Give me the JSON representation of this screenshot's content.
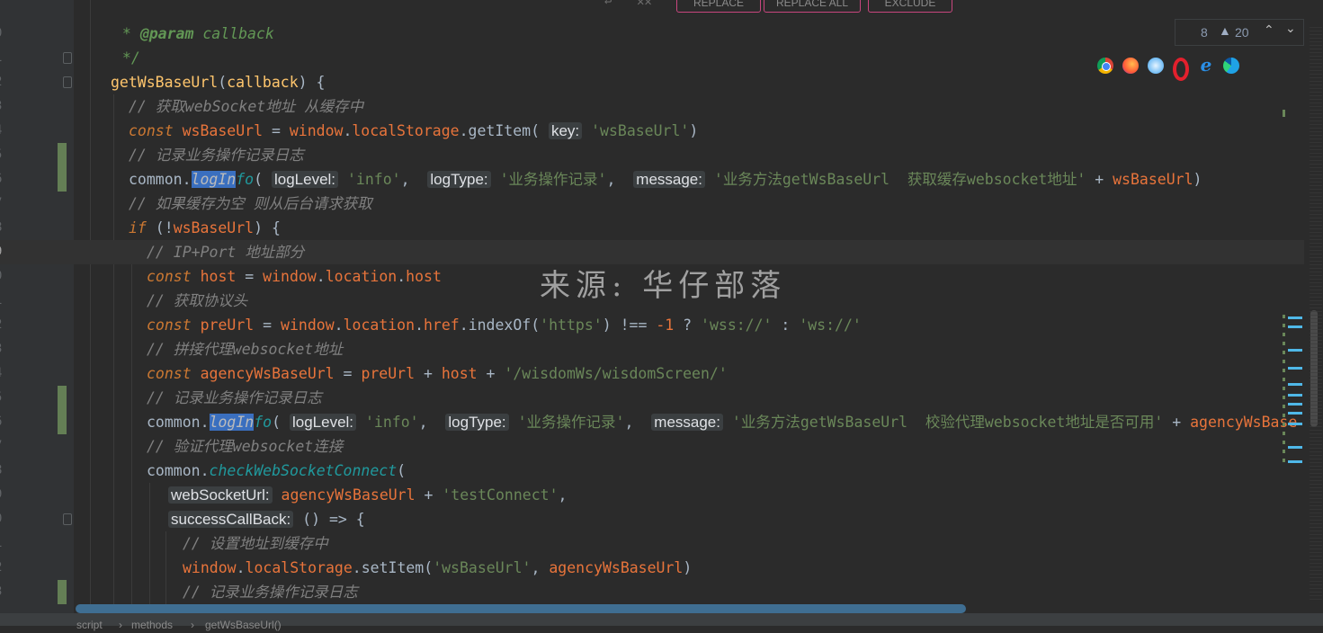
{
  "toolbar": {
    "replace_label": "REPLACE",
    "replace_all_label": "REPLACE ALL",
    "exclude_label": "EXCLUDE"
  },
  "inspections": {
    "count_a": "8",
    "warnings": "20"
  },
  "watermark": "来源: 华仔部落",
  "breadcrumb": {
    "items": [
      "script",
      "methods",
      "getWsBaseUrl()"
    ]
  },
  "editor": {
    "current_line_index": 7,
    "lines": [
      {
        "num": "0"
      },
      {
        "num": "1"
      },
      {
        "num": "2"
      },
      {
        "num": "3"
      },
      {
        "num": "4"
      },
      {
        "num": "5"
      },
      {
        "num": "6"
      },
      {
        "num": "7"
      },
      {
        "num": "8"
      },
      {
        "num": "9"
      },
      {
        "num": "0"
      },
      {
        "num": "1"
      },
      {
        "num": "2"
      },
      {
        "num": "3"
      },
      {
        "num": "4"
      },
      {
        "num": "5"
      },
      {
        "num": "6"
      },
      {
        "num": "7"
      },
      {
        "num": "8"
      },
      {
        "num": "9"
      },
      {
        "num": "0"
      },
      {
        "num": "1"
      },
      {
        "num": "2"
      },
      {
        "num": "3"
      }
    ],
    "code": {
      "l0_a": " * ",
      "l0_tag": "@param",
      "l0_b": " callback",
      "l1": " */",
      "l2_fn": "getWsBaseUrl",
      "l2_b": "(",
      "l2_arg": "callback",
      "l2_c": ") {",
      "l3": "// 获取webSocket地址 从缓存中",
      "l4_kw": "const",
      "l4_var": "wsBaseUrl",
      "l4_eq": " = ",
      "l4_win": "window",
      "l4_d1": ".",
      "l4_ls": "localStorage",
      "l4_d2": ".",
      "l4_gi": "getItem",
      "l4_p": "( ",
      "l4_hint": "key:",
      "l4_str": "'wsBaseUrl'",
      "l4_end": ")",
      "l5": "// 记录业务操作记录日志",
      "l6_obj": "common.",
      "l6_fn_a": "logIn",
      "l6_fn_b": "fo",
      "l6_p": "( ",
      "l6_h1": "logLevel:",
      "l6_s1": "'info'",
      "l6_c1": ",  ",
      "l6_h2": "logType:",
      "l6_s2": "'业务操作记录'",
      "l6_c2": ",  ",
      "l6_h3": "message:",
      "l6_s3": "'业务方法getWsBaseUrl  获取缓存websocket地址'",
      "l6_plus": " + ",
      "l6_var": "wsBaseUrl",
      "l6_end": ")",
      "l7": "// 如果缓存为空 则从后台请求获取",
      "l8_kw": "if",
      "l8_b": " (!",
      "l8_var": "wsBaseUrl",
      "l8_c": ") {",
      "l9": "// IP+Port 地址部分",
      "l10_kw": "const",
      "l10_var": "host",
      "l10_eq": " = ",
      "l10_win": "window",
      "l10_d": ".",
      "l10_loc": "location",
      "l10_d2": ".",
      "l10_host": "host",
      "l11": "// 获取协议头",
      "l12_kw": "const",
      "l12_var": "preUrl",
      "l12_eq": " = ",
      "l12_win": "window",
      "l12_d": ".",
      "l12_loc": "location",
      "l12_d2": ".",
      "l12_href": "href",
      "l12_d3": ".",
      "l12_io": "indexOf",
      "l12_p": "(",
      "l12_s": "'https'",
      "l12_ne": ") !== ",
      "l12_n": "-1",
      "l12_q": " ? ",
      "l12_s2": "'wss://'",
      "l12_col": " : ",
      "l12_s3": "'ws://'",
      "l13": "// 拼接代理websocket地址",
      "l14_kw": "const",
      "l14_var": "agencyWsBaseUrl",
      "l14_eq": " = ",
      "l14_v1": "preUrl",
      "l14_p": " + ",
      "l14_v2": "host",
      "l14_p2": " + ",
      "l14_s": "'/wisdomWs/wisdomScreen/'",
      "l15": "// 记录业务操作记录日志",
      "l16_obj": "common.",
      "l16_fn_a": "logIn",
      "l16_fn_b": "fo",
      "l16_p": "( ",
      "l16_h1": "logLevel:",
      "l16_s1": "'info'",
      "l16_c1": ",  ",
      "l16_h2": "logType:",
      "l16_s2": "'业务操作记录'",
      "l16_c2": ",  ",
      "l16_h3": "message:",
      "l16_s3": "'业务方法getWsBaseUrl  校验代理websocket地址是否可用'",
      "l16_plus": " + ",
      "l16_var": "agencyWsBase",
      "l17": "// 验证代理websocket连接",
      "l18_obj": "common.",
      "l18_fn": "checkWebSocketConnect",
      "l18_p": "(",
      "l19_hint": "webSocketUrl:",
      "l19_var": "agencyWsBaseUrl",
      "l19_p": " + ",
      "l19_s": "'testConnect'",
      "l19_c": ",",
      "l20_hint": "successCallBack:",
      "l20_b": "() => {",
      "l21": "// 设置地址到缓存中",
      "l22_win": "window",
      "l22_d": ".",
      "l22_ls": "localStorage",
      "l22_d2": ".",
      "l22_si": "setItem",
      "l22_p": "(",
      "l22_s": "'wsBaseUrl'",
      "l22_c": ", ",
      "l22_var": "agencyWsBaseUrl",
      "l22_end": ")",
      "l23": "// 记录业务操作记录日志"
    }
  },
  "colors": {
    "background": "#2b2b2b",
    "gutter": "#313335",
    "keyword": "#cc7832",
    "string": "#6a8759",
    "comment": "#808080",
    "variable": "#e8743b",
    "highlight": "#3a6fbf"
  }
}
